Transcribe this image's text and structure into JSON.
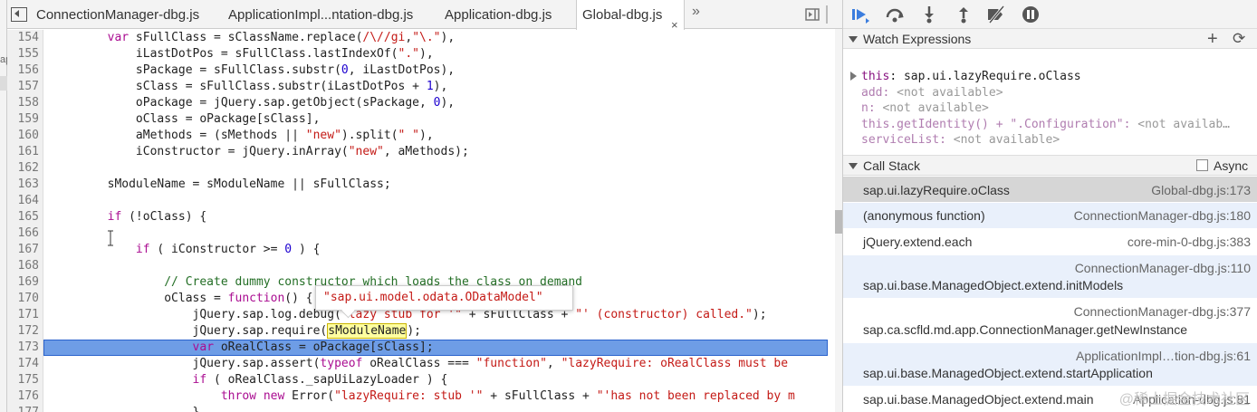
{
  "sidebar_strip": {
    "text": "ap"
  },
  "tabs": [
    {
      "label": "ConnectionManager-dbg.js"
    },
    {
      "label": "ApplicationImpl...ntation-dbg.js"
    },
    {
      "label": "Application-dbg.js"
    },
    {
      "label": "Global-dbg.js",
      "close": "×"
    }
  ],
  "more_tabs": "»",
  "editor": {
    "lines": [
      {
        "num": "154",
        "code": "        var sFullClass = sClassName.replace(/\\//gi,\"\\.\"),",
        "kind": "kw-start"
      },
      {
        "num": "155",
        "code": "            iLastDotPos = sFullClass.lastIndexOf(\".\"),"
      },
      {
        "num": "156",
        "code": "            sPackage = sFullClass.substr(0, iLastDotPos),"
      },
      {
        "num": "157",
        "code": "            sClass = sFullClass.substr(iLastDotPos + 1),"
      },
      {
        "num": "158",
        "code": "            oPackage = jQuery.sap.getObject(sPackage, 0),"
      },
      {
        "num": "159",
        "code": "            oClass = oPackage[sClass],"
      },
      {
        "num": "160",
        "code": "            aMethods = (sMethods || \"new\").split(\" \"),"
      },
      {
        "num": "161",
        "code": "            iConstructor = jQuery.inArray(\"new\", aMethods);"
      },
      {
        "num": "162",
        "code": ""
      },
      {
        "num": "163",
        "code": "        sModuleName = sModuleName || sFullClass;"
      },
      {
        "num": "164",
        "code": ""
      },
      {
        "num": "165",
        "code": "        if (!oClass) {"
      },
      {
        "num": "166",
        "code": ""
      },
      {
        "num": "167",
        "code": "            if ( iConstructor >= 0 ) {"
      },
      {
        "num": "168",
        "code": ""
      },
      {
        "num": "169",
        "code": "                // Create dummy constructor which loads the class on demand"
      },
      {
        "num": "170",
        "code": "                oClass = function() {"
      },
      {
        "num": "171",
        "code": "                    jQuery.sap.log.debug(\"lazy stub for '\" + sFullClass + \"' (constructor) called.\");"
      },
      {
        "num": "172",
        "code": "                    jQuery.sap.require(sModuleName);"
      },
      {
        "num": "173",
        "code": "                    var oRealClass = oPackage[sClass];"
      },
      {
        "num": "174",
        "code": "                    jQuery.sap.assert(typeof oRealClass === \"function\", \"lazyRequire: oRealClass must be"
      },
      {
        "num": "175",
        "code": "                    if ( oRealClass._sapUiLazyLoader ) {"
      },
      {
        "num": "176",
        "code": "                        throw new Error(\"lazyRequire: stub '\" + sFullClass + \"'has not been replaced by m"
      },
      {
        "num": "177",
        "code": "                    }"
      }
    ],
    "tooltip": "\"sap.ui.model.odata.ODataModel\""
  },
  "watch": {
    "title": "Watch Expressions",
    "add_icon": "+",
    "refresh_icon": "⟳",
    "root_key": "this",
    "root_value": "sap.ui.lazyRequire.oClass",
    "children": [
      {
        "key": "add",
        "value": "<not available>"
      },
      {
        "key": "n",
        "value": "<not available>"
      },
      {
        "key": "this.getIdentity() + \".Configuration\"",
        "value": "<not availab…"
      },
      {
        "key": "serviceList",
        "value": "<not available>"
      }
    ]
  },
  "call_stack": {
    "title": "Call Stack",
    "async_label": "Async",
    "frames": [
      {
        "fn": "sap.ui.lazyRequire.oClass",
        "loc": "Global-dbg.js:173"
      },
      {
        "fn": "(anonymous function)",
        "loc": "ConnectionManager-dbg.js:180"
      },
      {
        "fn": "jQuery.extend.each",
        "loc": "core-min-0-dbg.js:383"
      },
      {
        "fn": "sap.ui.base.ManagedObject.extend.initModels",
        "loc": "ConnectionManager-dbg.js:110"
      },
      {
        "fn": "sap.ca.scfld.md.app.ConnectionManager.getNewInstance",
        "loc": "ConnectionManager-dbg.js:377"
      },
      {
        "fn": "sap.ui.base.ManagedObject.extend.startApplication",
        "loc": "ApplicationImpl…tion-dbg.js:61"
      },
      {
        "fn": "sap.ui.base.ManagedObject.extend.main",
        "loc": "Application-dbg.js:81"
      }
    ]
  },
  "watermark": "@稀土掘金技术社区",
  "colors": {
    "highlight_line": "#6e9de6",
    "selected_frame": "#d6d6d6",
    "keyword": "#aa0d91",
    "string": "#c41a16"
  }
}
